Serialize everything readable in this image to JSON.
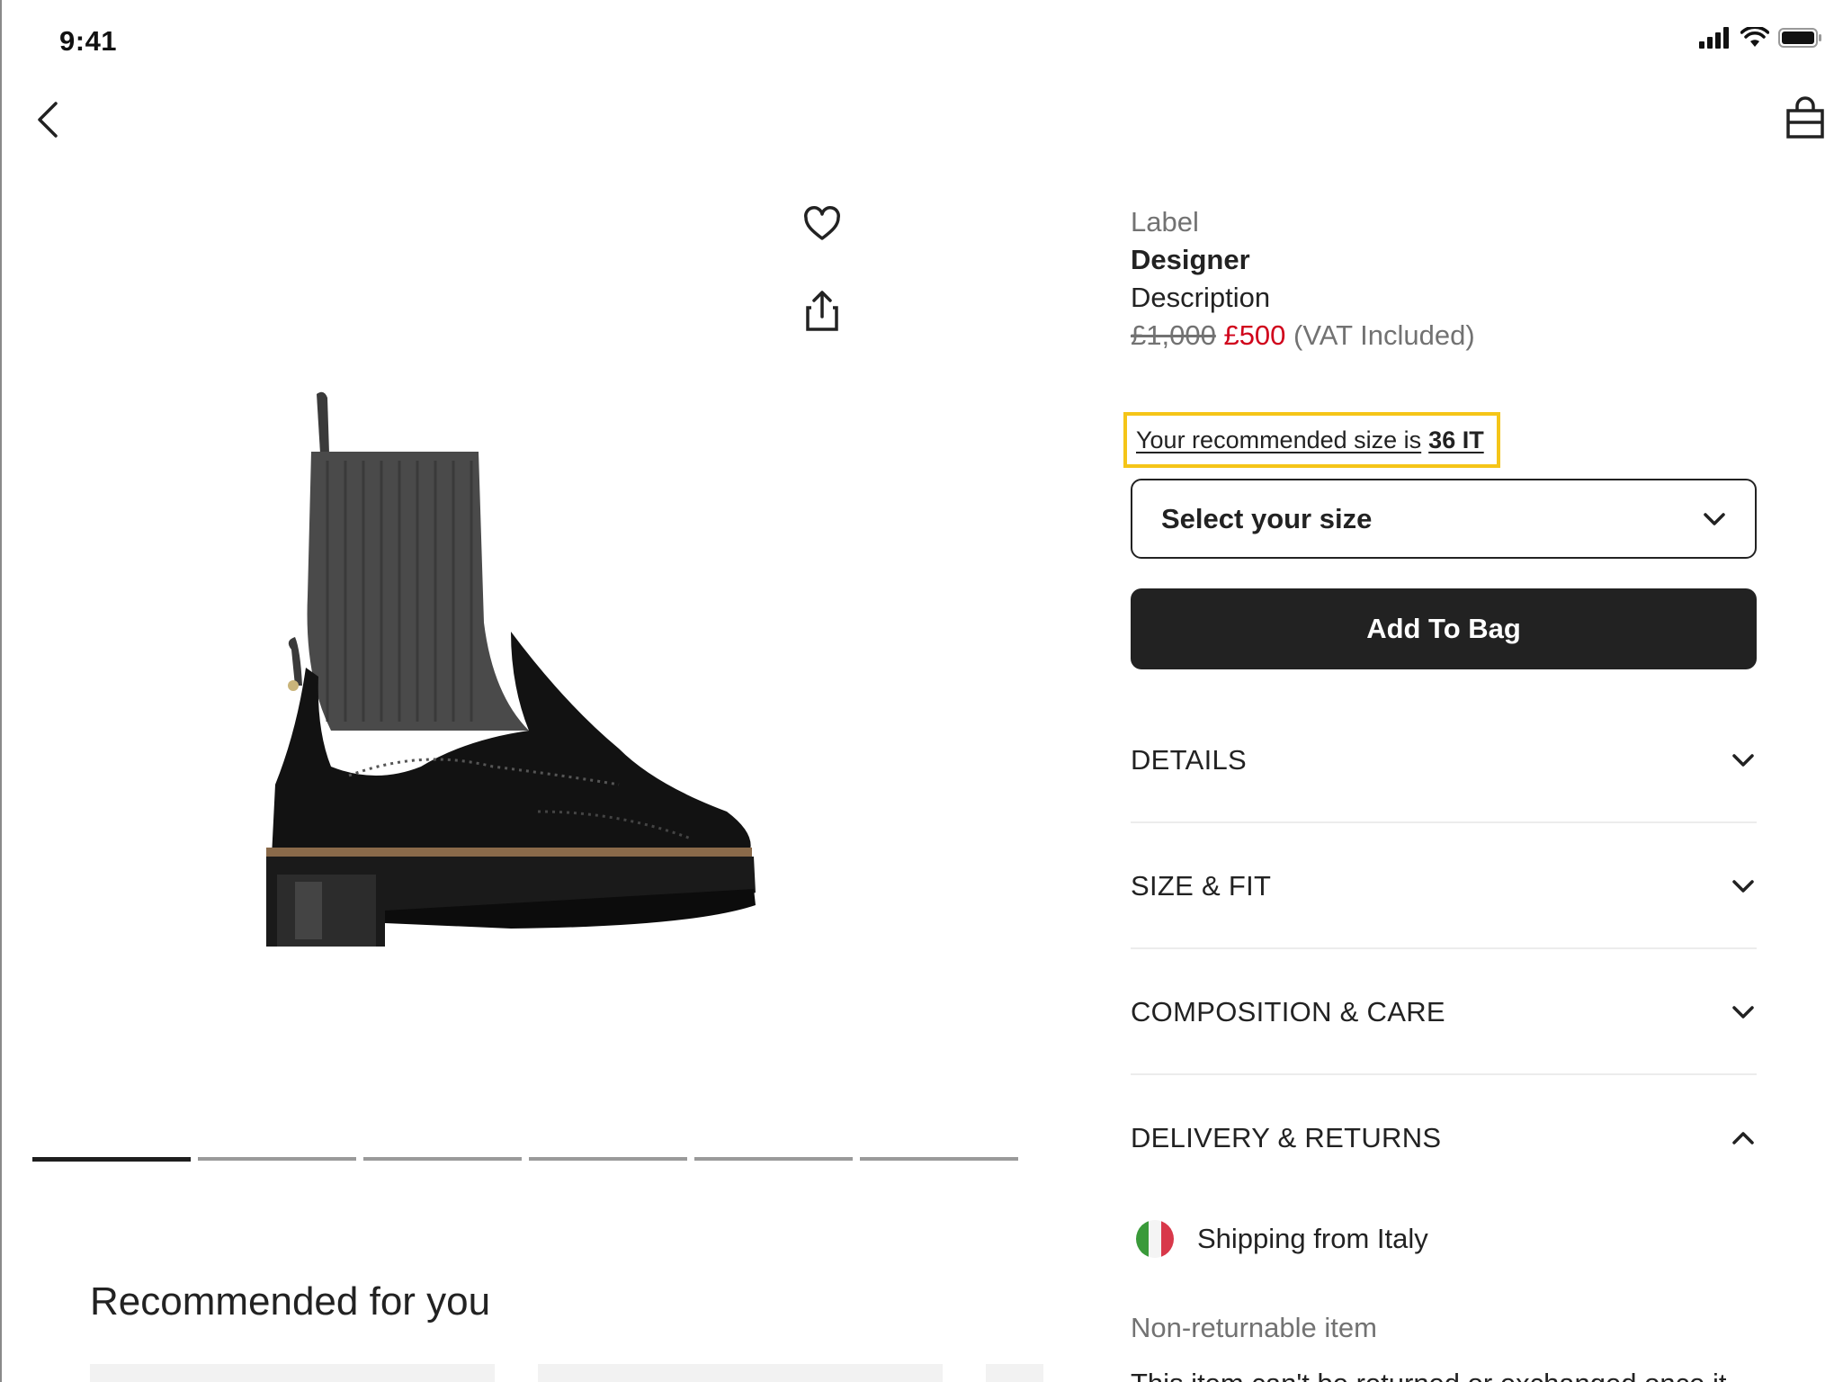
{
  "status_bar": {
    "time": "9:41"
  },
  "nav": {
    "back_icon": "chevron-left-icon",
    "bag_icon": "shopping-bag-icon"
  },
  "gallery": {
    "wishlist_icon": "heart-icon",
    "share_icon": "share-icon",
    "image_count": 6,
    "active_index": 0
  },
  "product": {
    "label": "Label",
    "designer": "Designer",
    "description": "Description",
    "price_original": "£1,000",
    "price_sale": "£500",
    "vat_note": "(VAT Included)",
    "recommended_size_text": "Your recommended size is",
    "recommended_size_value": "36 IT",
    "size_select_label": "Select your size",
    "add_to_bag_label": "Add To Bag"
  },
  "accordions": [
    {
      "label": "DETAILS",
      "expanded": false
    },
    {
      "label": "SIZE & FIT",
      "expanded": false
    },
    {
      "label": "COMPOSITION & CARE",
      "expanded": false
    },
    {
      "label": "DELIVERY & RETURNS",
      "expanded": true
    }
  ],
  "delivery": {
    "shipping_text": "Shipping from Italy",
    "non_returnable": "Non-returnable item",
    "partial_text": "This item can't be returned or exchanged once it"
  },
  "recommended": {
    "title": "Recommended for you"
  },
  "colors": {
    "accent_red": "#d0021b",
    "highlight_yellow": "#f5c518",
    "button_dark": "#222222"
  }
}
